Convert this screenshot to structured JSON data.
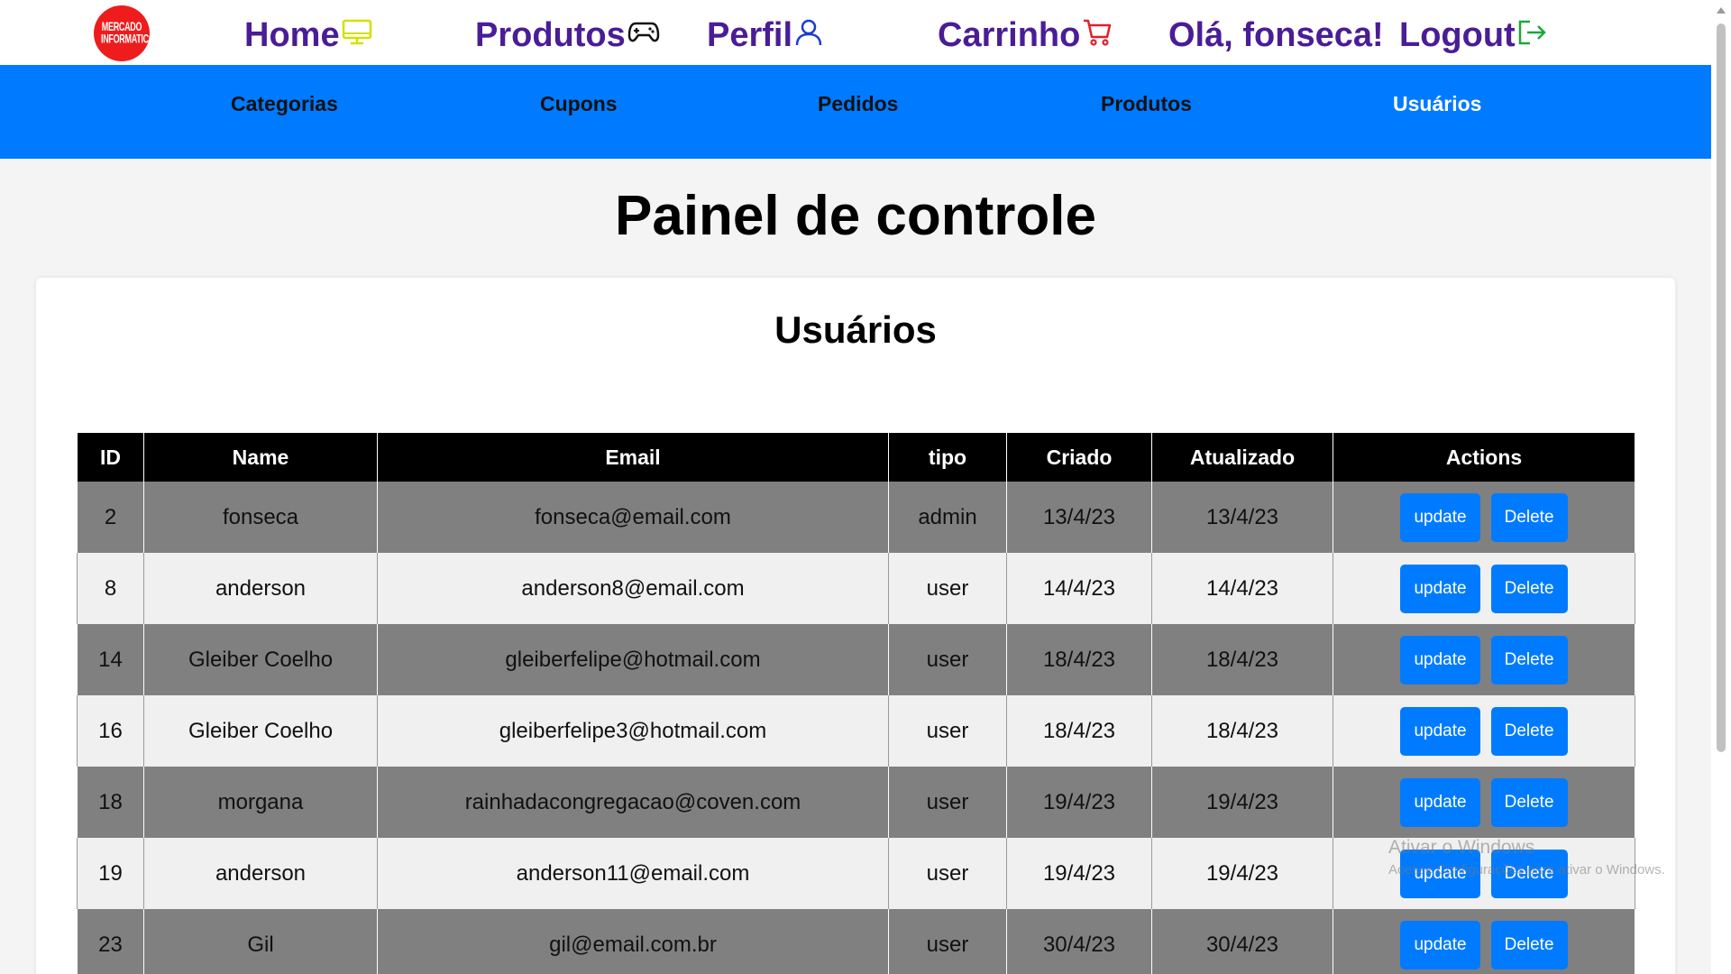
{
  "logo": {
    "text": "MERCADO INFORMATICO"
  },
  "nav": {
    "home": "Home",
    "produtos": "Produtos",
    "perfil": "Perfil",
    "carrinho": "Carrinho",
    "greeting": "Olá, fonseca!",
    "logout": "Logout"
  },
  "admin_nav": {
    "items": [
      "Categorias",
      "Cupons",
      "Pedidos",
      "Produtos",
      "Usuários"
    ],
    "active": "Usuários"
  },
  "page": {
    "title": "Painel de controle",
    "section_title": "Usuários"
  },
  "table": {
    "headers": [
      "ID",
      "Name",
      "Email",
      "tipo",
      "Criado",
      "Atualizado",
      "Actions"
    ],
    "rows": [
      {
        "id": "2",
        "name": "fonseca",
        "email": "fonseca@email.com",
        "tipo": "admin",
        "criado": "13/4/23",
        "atualizado": "13/4/23"
      },
      {
        "id": "8",
        "name": "anderson",
        "email": "anderson8@email.com",
        "tipo": "user",
        "criado": "14/4/23",
        "atualizado": "14/4/23"
      },
      {
        "id": "14",
        "name": "Gleiber Coelho",
        "email": "gleiberfelipe@hotmail.com",
        "tipo": "user",
        "criado": "18/4/23",
        "atualizado": "18/4/23"
      },
      {
        "id": "16",
        "name": "Gleiber Coelho",
        "email": "gleiberfelipe3@hotmail.com",
        "tipo": "user",
        "criado": "18/4/23",
        "atualizado": "18/4/23"
      },
      {
        "id": "18",
        "name": "morgana",
        "email": "rainhadacongregacao@coven.com",
        "tipo": "user",
        "criado": "19/4/23",
        "atualizado": "19/4/23"
      },
      {
        "id": "19",
        "name": "anderson",
        "email": "anderson11@email.com",
        "tipo": "user",
        "criado": "19/4/23",
        "atualizado": "19/4/23"
      },
      {
        "id": "23",
        "name": "Gil",
        "email": "gil@email.com.br",
        "tipo": "user",
        "criado": "30/4/23",
        "atualizado": "30/4/23"
      }
    ],
    "update_label": "update",
    "delete_label": "Delete"
  },
  "watermark": {
    "line1": "Ativar o Windows",
    "line2": "Acesse Configurações para ativar o Windows."
  },
  "colors": {
    "nav_text": "#4a1d96",
    "admin_bar": "#007bff",
    "button": "#007bff",
    "home_icon": "#d4e000",
    "perfil_icon": "#1a3ccc",
    "carrinho_icon": "#e0202a",
    "logout_icon": "#1ba83a"
  },
  "icons": {
    "home": "monitor-icon",
    "produtos": "gamepad-icon",
    "perfil": "user-icon",
    "carrinho": "cart-icon",
    "logout": "logout-icon"
  }
}
